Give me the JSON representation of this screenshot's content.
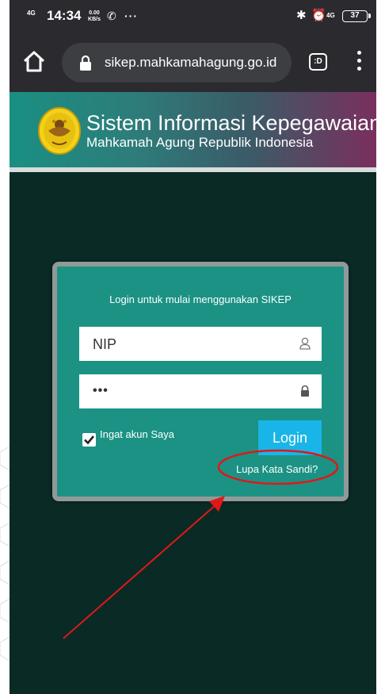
{
  "status_bar": {
    "network": "4G",
    "time": "14:34",
    "speed_value": "0.00",
    "speed_unit": "KB/s",
    "more": "···",
    "network_right": "4G",
    "battery": "37"
  },
  "browser": {
    "url": "sikep.mahkamahagung.go.id",
    "tab_label": ":D"
  },
  "site": {
    "title": "Sistem Informasi Kepegawaian",
    "subtitle": "Mahkamah Agung Republik Indonesia"
  },
  "login": {
    "heading": "Login untuk mulai menggunakan SIKEP",
    "nip_value": "NIP",
    "password_value": "•••",
    "remember_label": "Ingat akun Saya",
    "remember_checked": true,
    "login_button": "Login",
    "forgot_link": "Lupa Kata Sandi?"
  },
  "colors": {
    "page_background": "#0a2a26",
    "card_background": "#1b9284",
    "login_button": "#19b5e8",
    "annotation": "#e01818"
  },
  "icons": {
    "home": "home-icon",
    "lock": "lock-icon",
    "tabs": "tab-switcher-icon",
    "menu": "more-vert-icon",
    "user": "user-icon",
    "password": "lock-icon",
    "checkbox": "checkmark-icon"
  }
}
